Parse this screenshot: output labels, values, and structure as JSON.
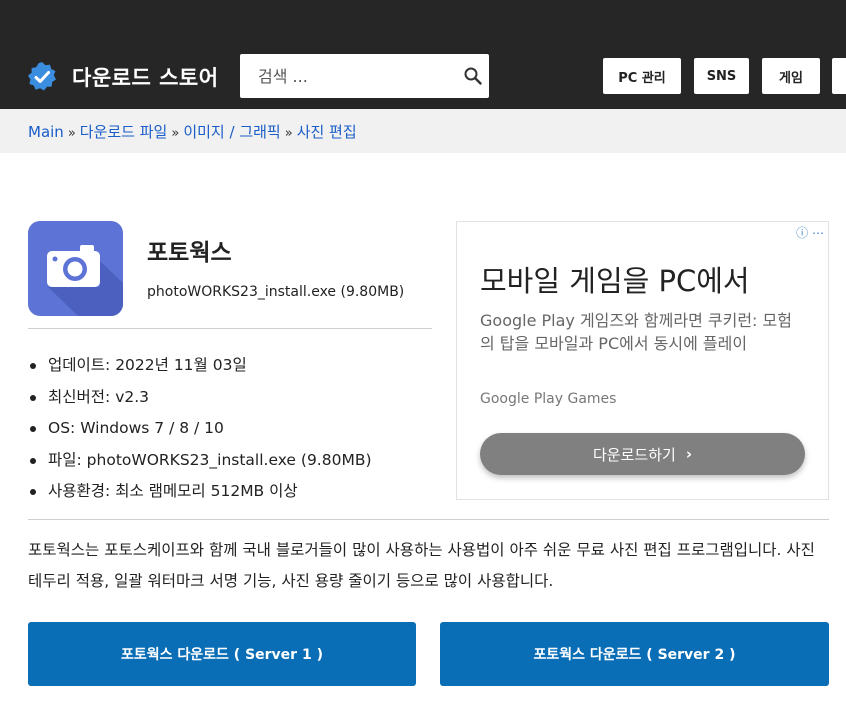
{
  "header": {
    "site_title": "다운로드 스토어",
    "search_placeholder": "검색 ...",
    "nav": [
      "PC 관리",
      "SNS",
      "게임"
    ]
  },
  "breadcrumb": {
    "items": [
      "Main",
      "다운로드 파일",
      "이미지 / 그래픽",
      "사진 편집"
    ],
    "separator": "»"
  },
  "app": {
    "title": "포토웍스",
    "file": "photoWORKS23_install.exe (9.80MB)",
    "info": [
      "업데이트: 2022년 11월 03일",
      "최신버전: v2.3",
      "OS: Windows 7 / 8 / 10",
      "파일: photoWORKS23_install.exe (9.80MB)",
      "사용환경: 최소 램메모리 512MB 이상"
    ],
    "description": "포토웍스는 포토스케이프와 함께 국내 블로거들이 많이 사용하는 사용법이 아주 쉬운 무료 사진 편집 프로그램입니다. 사진테두리 적용, 일괄 워터마크 서명 기능, 사진 용량 줄이기 등으로 많이 사용합니다."
  },
  "ad": {
    "title": "모바일 게임을 PC에서",
    "description": "Google Play 게임즈와 함께라면 쿠키런: 모험의 탑을 모바일과 PC에서 동시에 플레이",
    "brand": "Google Play Games",
    "cta": "다운로드하기"
  },
  "downloads": {
    "server1": "포토웍스 다운로드 ( Server 1 )",
    "server2": "포토웍스 다운로드 ( Server 2 )"
  },
  "colors": {
    "header_bg": "#262626",
    "link": "#1a5dc8",
    "download_button": "#0a6eb7",
    "app_icon_bg": "#5d74d6",
    "ad_button": "#808080"
  }
}
